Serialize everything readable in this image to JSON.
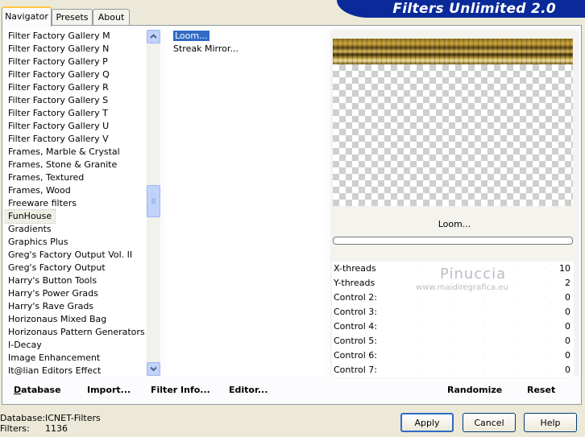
{
  "tabs": [
    {
      "label": "Navigator",
      "active": true
    },
    {
      "label": "Presets",
      "active": false
    },
    {
      "label": "About",
      "active": false
    }
  ],
  "app_title": "Filters Unlimited 2.0",
  "categories": [
    "Filter Factory Gallery M",
    "Filter Factory Gallery N",
    "Filter Factory Gallery P",
    "Filter Factory Gallery Q",
    "Filter Factory Gallery R",
    "Filter Factory Gallery S",
    "Filter Factory Gallery T",
    "Filter Factory Gallery U",
    "Filter Factory Gallery V",
    "Frames, Marble & Crystal",
    "Frames, Stone & Granite",
    "Frames, Textured",
    "Frames, Wood",
    "Freeware filters",
    "FunHouse",
    "Gradients",
    "Graphics Plus",
    "Greg's Factory Output Vol. II",
    "Greg's Factory Output",
    "Harry's Button Tools",
    "Harry's Power Grads",
    "Harry's Rave Grads",
    "Horizonaus Mixed Bag",
    "Horizonaus Pattern Generators",
    "I-Decay",
    "Image Enhancement",
    "It@lian Editors Effect"
  ],
  "selected_category": "FunHouse",
  "filters": [
    "Loom...",
    "Streak Mirror..."
  ],
  "selected_filter": "Loom...",
  "current_filter_title": "Loom...",
  "controls": [
    {
      "label": "X-threads",
      "value": "10"
    },
    {
      "label": "Y-threads",
      "value": "2"
    },
    {
      "label": "Control 2:",
      "value": "0"
    },
    {
      "label": "Control 3:",
      "value": "0"
    },
    {
      "label": "Control 4:",
      "value": "0"
    },
    {
      "label": "Control 5:",
      "value": "0"
    },
    {
      "label": "Control 6:",
      "value": "0"
    },
    {
      "label": "Control 7:",
      "value": "0"
    }
  ],
  "bottom_links": {
    "database": "Database",
    "import": "Import...",
    "filter_info": "Filter Info...",
    "editor": "Editor...",
    "randomize": "Randomize",
    "reset": "Reset"
  },
  "watermark": {
    "name": "Pinuccia",
    "url": "www.maidiregrafica.eu"
  },
  "status": {
    "database_label": "Database:",
    "database_value": "ICNET-Filters",
    "filters_label": "Filters:",
    "filters_value": "1136"
  },
  "buttons": {
    "apply": "Apply",
    "cancel": "Cancel",
    "help": "Help"
  },
  "colors": {
    "banner": "#0a2a9a",
    "selection": "#316ac5",
    "panel": "#ece9d8"
  }
}
